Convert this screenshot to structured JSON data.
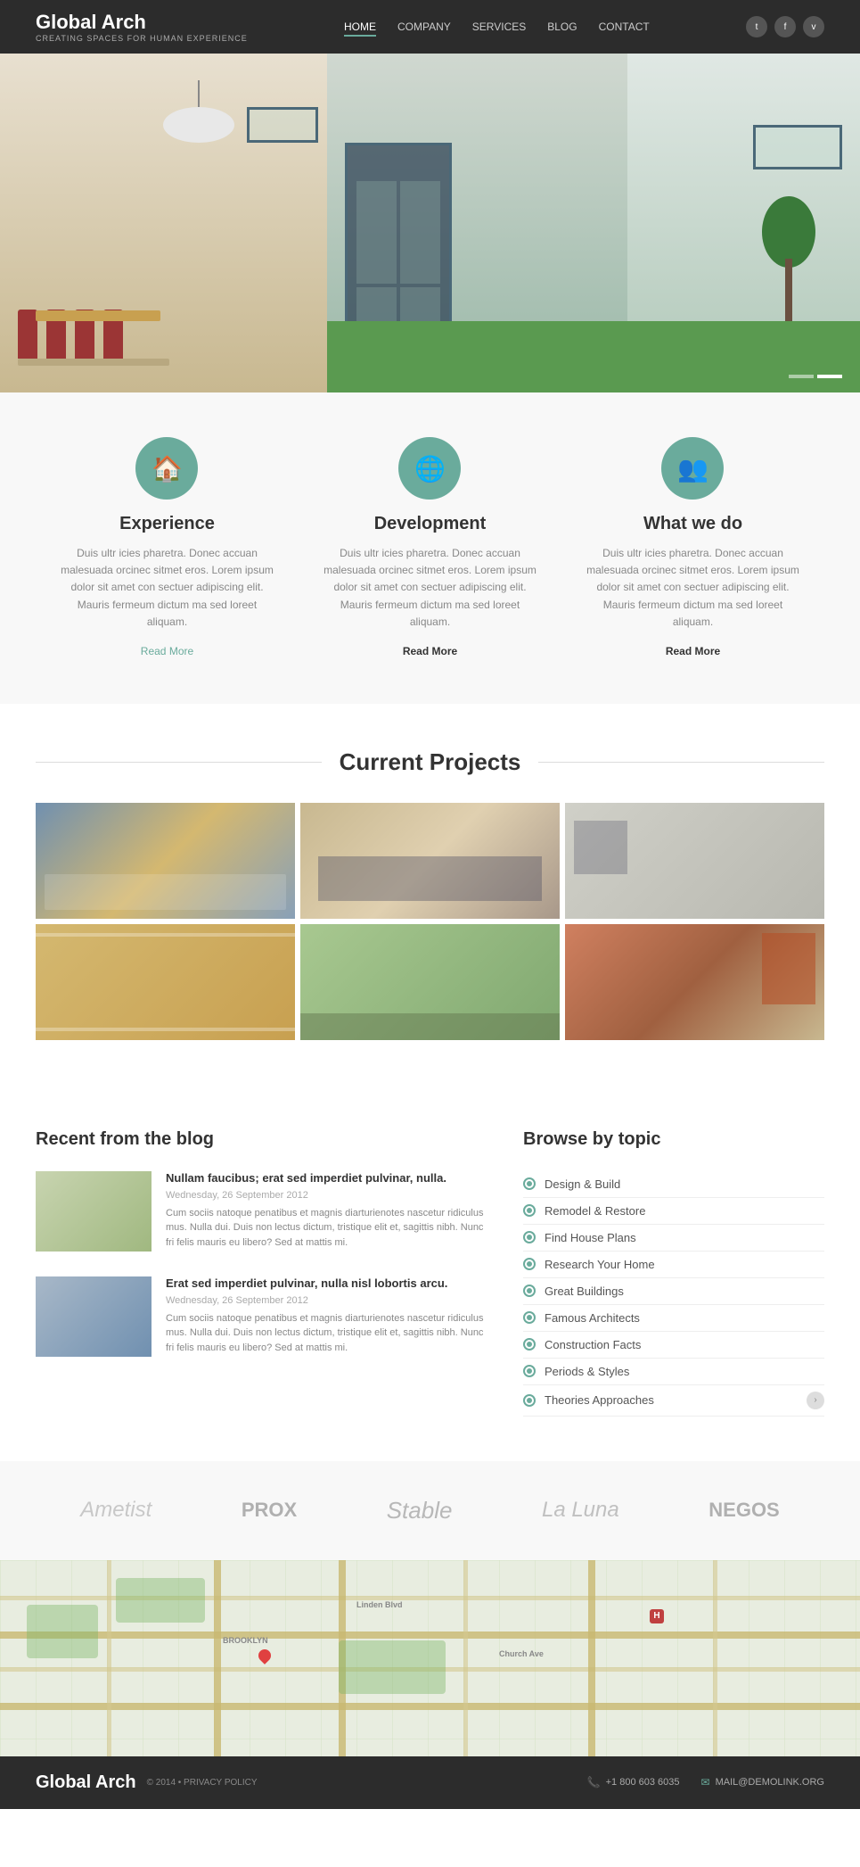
{
  "header": {
    "logo_title": "Global Arch",
    "logo_subtitle": "CREATING SPACES FOR HUMAN EXPERIENCE",
    "nav": [
      {
        "label": "HOME",
        "active": true
      },
      {
        "label": "COMPANY",
        "active": false
      },
      {
        "label": "SERVICES",
        "active": false
      },
      {
        "label": "BLOG",
        "active": false
      },
      {
        "label": "CONTACT",
        "active": false
      }
    ],
    "social": [
      "t",
      "f",
      "v"
    ]
  },
  "features": [
    {
      "icon": "🏠",
      "title": "Experience",
      "text": "Duis ultr icies pharetra. Donec accuan malesuada orcinec sitmet eros. Lorem ipsum dolor sit amet con sectuer adipiscing elit. Mauris fermeum dictum ma sed loreet aliquam.",
      "link": "Read More",
      "link_style": "teal"
    },
    {
      "icon": "🌐",
      "title": "Development",
      "text": "Duis ultr icies pharetra. Donec accuan malesuada orcinec sitmet eros. Lorem ipsum dolor sit amet con sectuer adipiscing elit. Mauris fermeum dictum ma sed loreet aliquam.",
      "link": "Read More",
      "link_style": "bold"
    },
    {
      "icon": "👥",
      "title": "What we do",
      "text": "Duis ultr icies pharetra. Donec accuan malesuada orcinec sitmet eros. Lorem ipsum dolor sit amet con sectuer adipiscing elit. Mauris fermeum dictum ma sed loreet aliquam.",
      "link": "Read More",
      "link_style": "bold"
    }
  ],
  "projects": {
    "title": "Current Projects"
  },
  "blog": {
    "title": "Recent from the blog",
    "posts": [
      {
        "title": "Nullam faucibus; erat sed imperdiet pulvinar, nulla.",
        "date": "Wednesday, 26 September 2012",
        "excerpt": "Cum sociis natoque penatibus et magnis diarturienotes nascetur ridiculus mus. Nulla dui. Duis non lectus dictum, tristique elit et, sagittis nibh. Nunc fri felis mauris eu libero? Sed at mattis mi."
      },
      {
        "title": "Erat sed imperdiet pulvinar, nulla nisl lobortis arcu.",
        "date": "Wednesday, 26 September 2012",
        "excerpt": "Cum sociis natoque penatibus et magnis diarturienotes nascetur ridiculus mus. Nulla dui. Duis non lectus dictum, tristique elit et, sagittis nibh. Nunc fri felis mauris eu libero? Sed at mattis mi."
      }
    ]
  },
  "browse": {
    "title": "Browse by topic",
    "items": [
      "Design & Build",
      "Remodel & Restore",
      "Find House Plans",
      "Research Your Home",
      "Great Buildings",
      "Famous Architects",
      "Construction Facts",
      "Periods & Styles",
      "Theories Approaches"
    ]
  },
  "partners": [
    "Ametist",
    "PROX",
    "Stable",
    "La Luna",
    "NEGOS"
  ],
  "footer": {
    "logo": "Global Arch",
    "copy": "© 2014 • PRIVACY POLICY",
    "phone": "+1 800 603 6035",
    "email": "MAIL@DEMOLINK.ORG"
  }
}
